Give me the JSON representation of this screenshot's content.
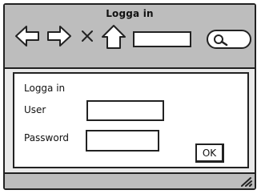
{
  "window": {
    "title": "Logga in"
  },
  "toolbar": {
    "back_icon": "left-arrow-icon",
    "forward_icon": "right-arrow-icon",
    "stop_icon": "close-icon",
    "home_icon": "home-icon",
    "search_icon": "search-icon",
    "url_value": "",
    "search_value": ""
  },
  "form": {
    "heading": "Logga in",
    "user_label": "User",
    "password_label": "Password",
    "user_value": "",
    "password_value": "",
    "ok_label": "OK"
  },
  "colors": {
    "chrome": "#bdbdbd",
    "window_bg": "#e9e9e9",
    "border": "#222222"
  }
}
